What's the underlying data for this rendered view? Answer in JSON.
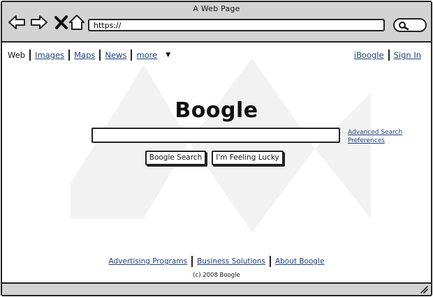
{
  "window": {
    "title": "A Web Page"
  },
  "toolbar": {
    "back_icon": "arrow-left-icon",
    "forward_icon": "arrow-right-icon",
    "stop_icon": "close-icon",
    "home_icon": "home-icon",
    "url": "https://",
    "search_icon": "search-icon"
  },
  "nav": {
    "items": [
      {
        "label": "Web",
        "active": true
      },
      {
        "label": "Images"
      },
      {
        "label": "Maps"
      },
      {
        "label": "News"
      },
      {
        "label": "more"
      }
    ],
    "right_items": [
      {
        "label": "iBoogle"
      },
      {
        "label": "Sign In"
      }
    ]
  },
  "main": {
    "logo": "Boogle",
    "query": "",
    "advanced_links": [
      "Advanced Search",
      "Preferences"
    ],
    "search_button": "Boogle Search",
    "lucky_button": "I'm Feeling Lucky"
  },
  "footer": {
    "links": [
      "Advertising Programs",
      "Business Solutions",
      "About Boogle"
    ],
    "copyright": "(c) 2008 Boogle"
  },
  "colors": {
    "chrome": "#d3d3d3",
    "link": "#1f3f7a",
    "border": "#222222"
  }
}
